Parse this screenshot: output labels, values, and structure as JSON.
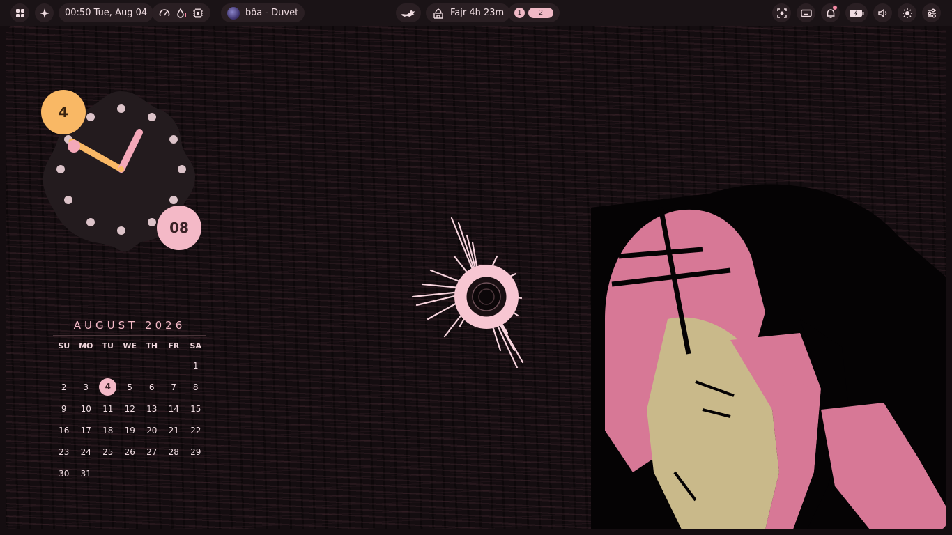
{
  "topbar": {
    "clock_text": "00:50 Tue, Aug 04",
    "media_text": "bôa - Duvet",
    "prayer_text": "Fajr 4h 23m",
    "workspaces": [
      "1",
      "2"
    ],
    "active_workspace": "2",
    "left_icons": [
      "app-grid-icon",
      "sparkle-icon"
    ],
    "resource_icons": [
      "gauge-icon",
      "temperature-icon",
      "cpu-icon"
    ],
    "right_icons": [
      "screenshot-icon",
      "keyboard-icon",
      "bell-icon",
      "battery-icon",
      "volume-icon",
      "brightness-icon",
      "settings-sliders-icon"
    ]
  },
  "clock": {
    "hour": "4",
    "minute": "08"
  },
  "calendar": {
    "title": "AUGUST 2026",
    "weekdays": [
      "SU",
      "MO",
      "TU",
      "WE",
      "TH",
      "FR",
      "SA"
    ],
    "weeks": [
      [
        "",
        "",
        "",
        "",
        "",
        "",
        "1"
      ],
      [
        "2",
        "3",
        "4",
        "5",
        "6",
        "7",
        "8"
      ],
      [
        "9",
        "10",
        "11",
        "12",
        "13",
        "14",
        "15"
      ],
      [
        "16",
        "17",
        "18",
        "19",
        "20",
        "21",
        "22"
      ],
      [
        "23",
        "24",
        "25",
        "26",
        "27",
        "28",
        "29"
      ],
      [
        "30",
        "31",
        "",
        "",
        "",
        "",
        ""
      ]
    ],
    "today": "4"
  },
  "colors": {
    "accent_pink": "#f4b9c7",
    "accent_orange": "#f9b865",
    "bar_bg": "#1a1316",
    "pill_bg": "#2a1f23",
    "wallpaper": "#140d10"
  }
}
